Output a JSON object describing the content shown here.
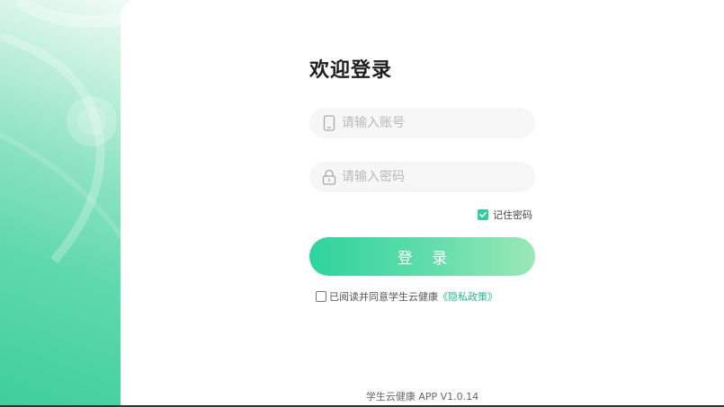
{
  "login": {
    "title": "欢迎登录",
    "account_placeholder": "请输入账号",
    "password_placeholder": "请输入密码",
    "remember_label": "记住密码",
    "remember_checked": true,
    "login_button_label": "登 录",
    "agreement_checked": false,
    "agreement_text": "已阅读并同意学生云健康",
    "privacy_link_label": "《隐私政策》"
  },
  "footer": {
    "version_text": "学生云健康 APP V1.0.14"
  },
  "icons": {
    "account": "phone-icon",
    "password": "lock-icon",
    "remember": "checkmark-icon"
  },
  "colors": {
    "accent": "#2ecf9c",
    "link": "#23b98b",
    "button_gradient_start": "#2fd39d",
    "button_gradient_end": "#9be8b7"
  }
}
